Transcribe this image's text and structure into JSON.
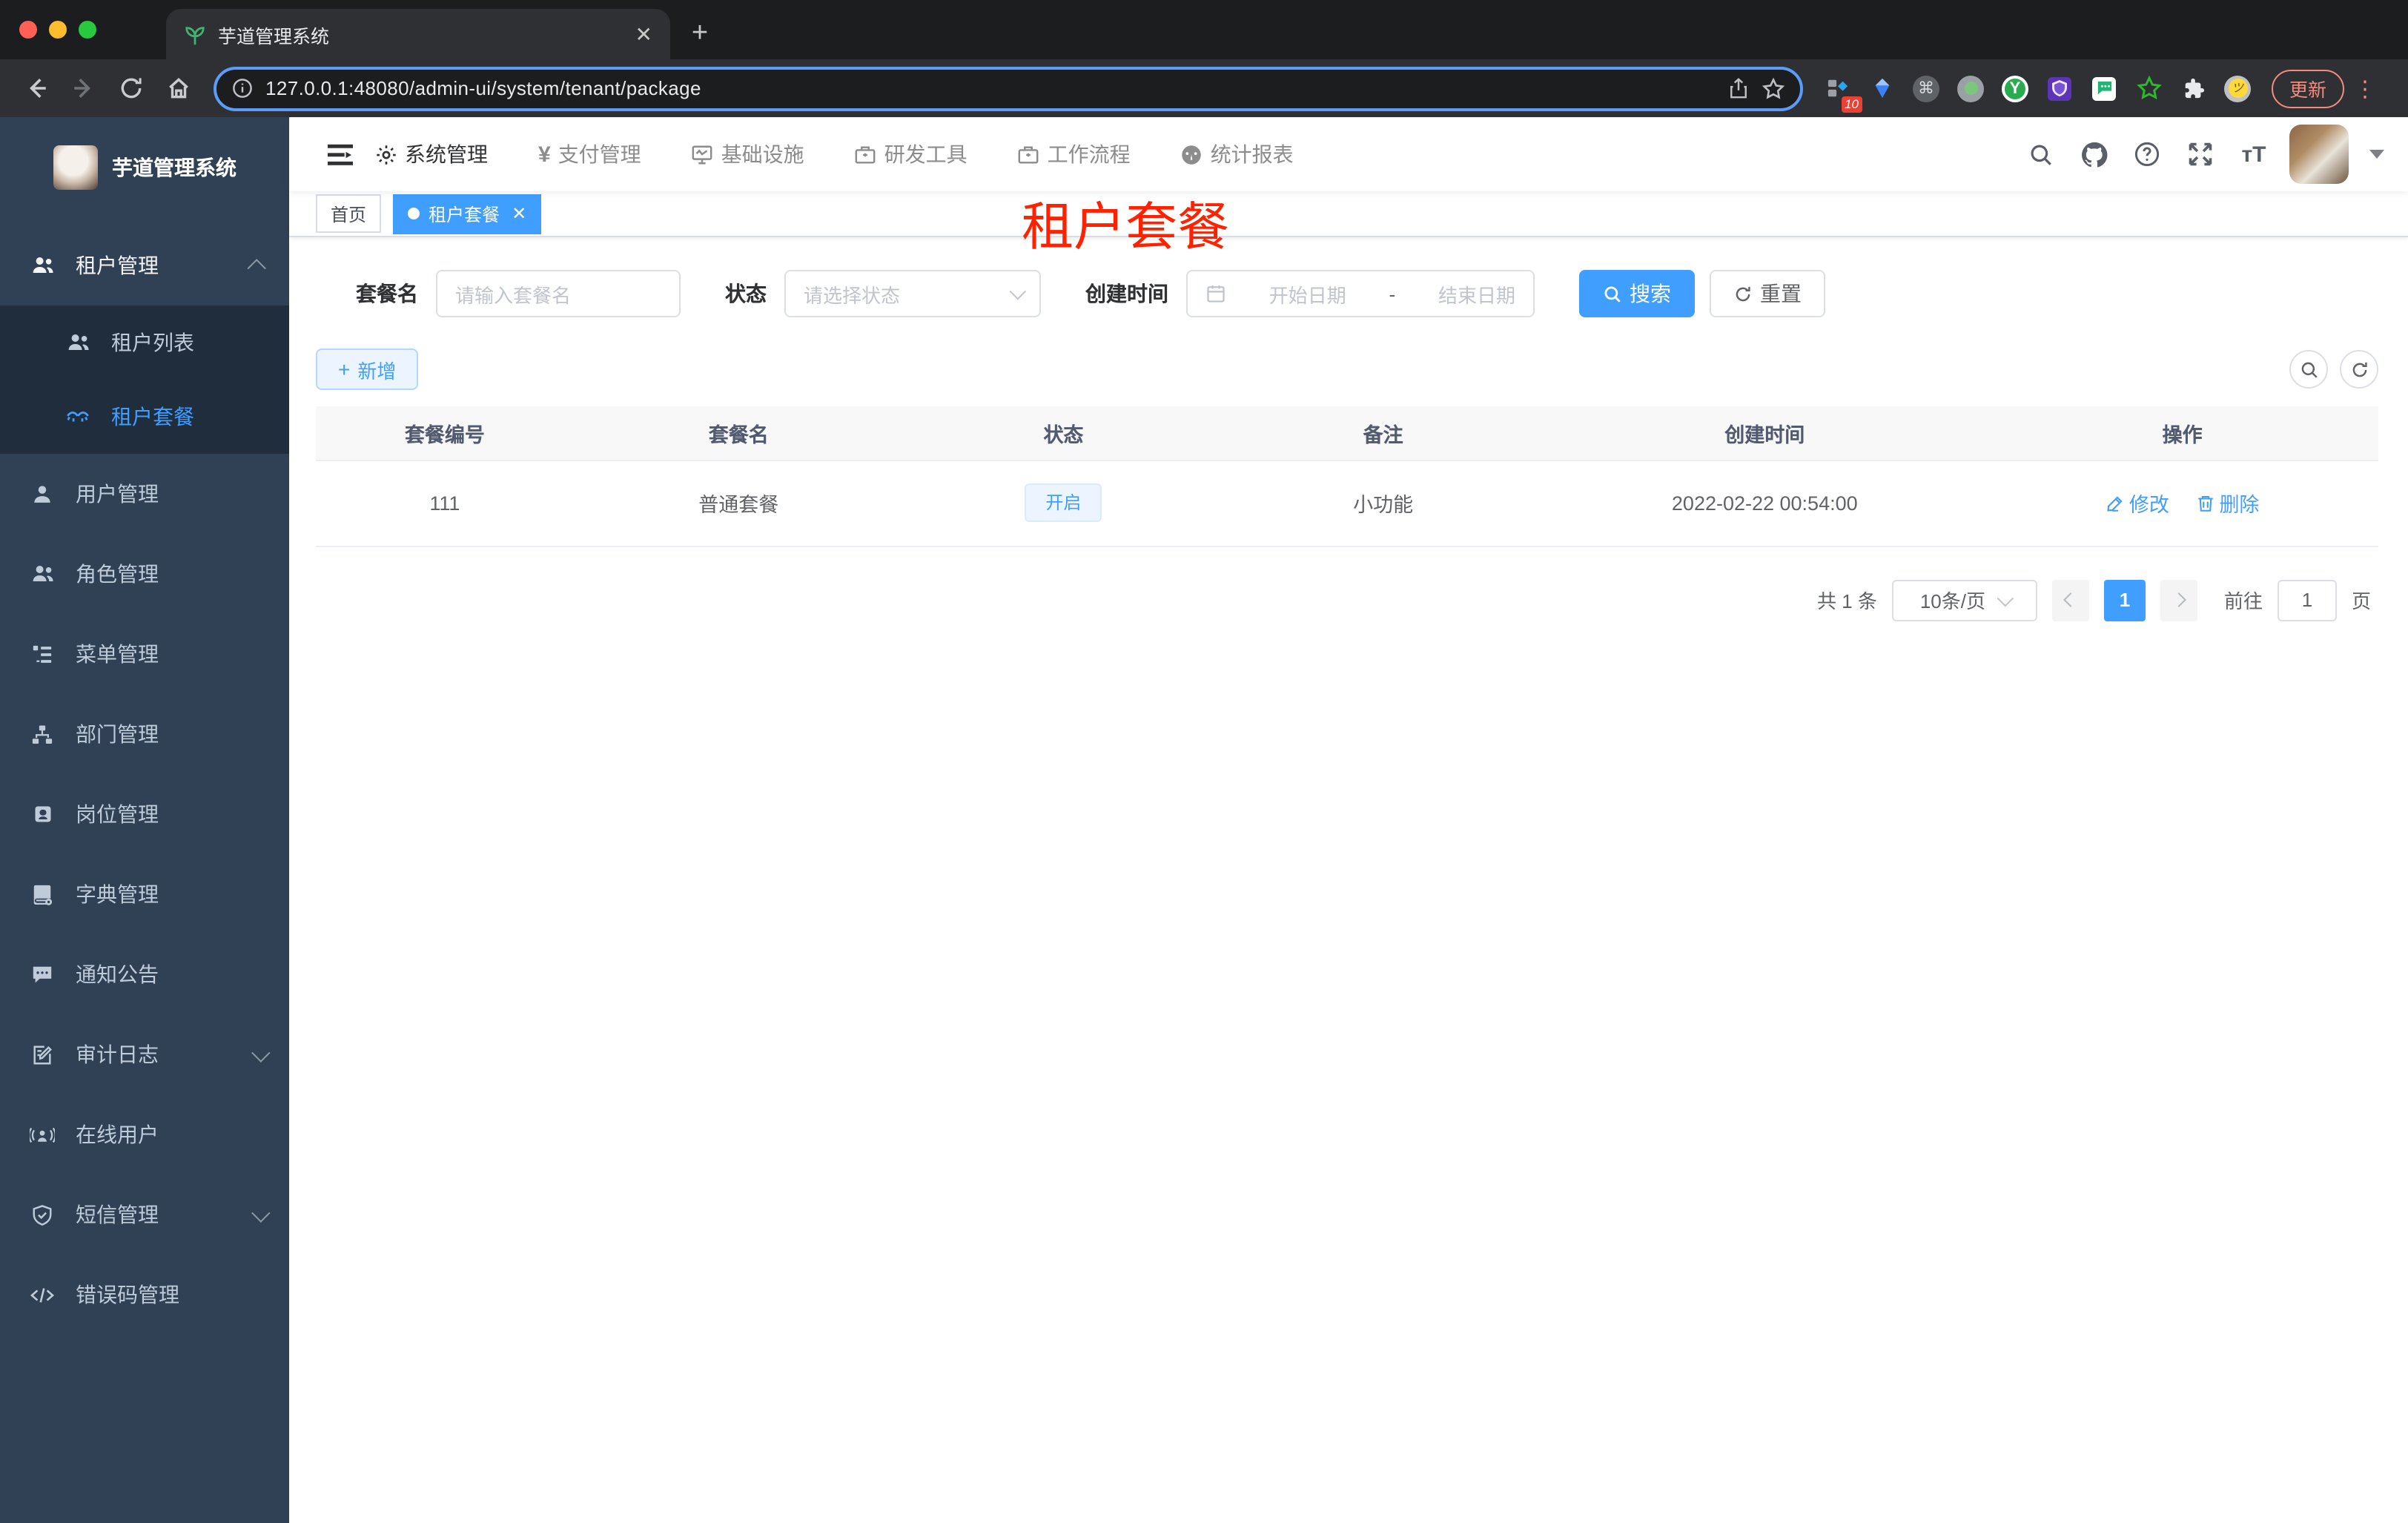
{
  "browser": {
    "tab_title": "芋道管理系统",
    "url": "127.0.0.1:48080/admin-ui/system/tenant/package",
    "update_label": "更新",
    "extension_badge": "10"
  },
  "colors": {
    "accent": "#409eff",
    "sidebar_bg": "#304156",
    "submenu_bg": "#1f2d3d",
    "overlay_red": "#ff2200",
    "update_pink": "#f28b82",
    "status_tag_bg": "#ecf5ff"
  },
  "sidebar": {
    "logo_title": "芋道管理系统",
    "items": [
      {
        "label": "租户管理",
        "icon": "peoples-icon",
        "expanded": true,
        "children": [
          {
            "label": "租户列表",
            "icon": "peoples-icon",
            "active": false
          },
          {
            "label": "租户套餐",
            "icon": "tenant-package-icon",
            "active": true
          }
        ]
      },
      {
        "label": "用户管理",
        "icon": "user-icon"
      },
      {
        "label": "角色管理",
        "icon": "role-icon"
      },
      {
        "label": "菜单管理",
        "icon": "menu-tree-icon"
      },
      {
        "label": "部门管理",
        "icon": "dept-tree-icon"
      },
      {
        "label": "岗位管理",
        "icon": "post-icon"
      },
      {
        "label": "字典管理",
        "icon": "dict-icon"
      },
      {
        "label": "通知公告",
        "icon": "notice-icon"
      },
      {
        "label": "审计日志",
        "icon": "log-icon",
        "collapsible": true
      },
      {
        "label": "在线用户",
        "icon": "online-user-icon"
      },
      {
        "label": "短信管理",
        "icon": "sms-icon",
        "collapsible": true
      },
      {
        "label": "错误码管理",
        "icon": "error-code-icon"
      }
    ]
  },
  "topnav": {
    "items": [
      {
        "label": "系统管理",
        "icon": "gear-icon",
        "active": true
      },
      {
        "label": "支付管理",
        "icon": "yen-icon",
        "active": false
      },
      {
        "label": "基础设施",
        "icon": "monitor-icon",
        "active": false
      },
      {
        "label": "研发工具",
        "icon": "toolbox-icon",
        "active": false
      },
      {
        "label": "工作流程",
        "icon": "workflow-icon",
        "active": false
      },
      {
        "label": "统计报表",
        "icon": "dashboard-icon",
        "active": false
      }
    ]
  },
  "tags": {
    "items": [
      {
        "label": "首页",
        "active": false
      },
      {
        "label": "租户套餐",
        "active": true
      }
    ]
  },
  "overlay_title": "租户套餐",
  "filters": {
    "name_label": "套餐名",
    "name_placeholder": "请输入套餐名",
    "status_label": "状态",
    "status_placeholder": "请选择状态",
    "date_label": "创建时间",
    "date_start_placeholder": "开始日期",
    "date_separator": "-",
    "date_end_placeholder": "结束日期",
    "search_label": "搜索",
    "reset_label": "重置"
  },
  "toolbar": {
    "add_label": "新增"
  },
  "table": {
    "headers": [
      "套餐编号",
      "套餐名",
      "状态",
      "备注",
      "创建时间",
      "操作"
    ],
    "rows": [
      {
        "id": "111",
        "name": "普通套餐",
        "status": "开启",
        "remark": "小功能",
        "created": "2022-02-22 00:54:00",
        "actions": [
          "修改",
          "删除"
        ]
      }
    ]
  },
  "pagination": {
    "total": "共 1 条",
    "page_size": "10条/页",
    "current_page": "1",
    "goto_label": "前往",
    "jump_value": "1",
    "unit_label": "页"
  }
}
